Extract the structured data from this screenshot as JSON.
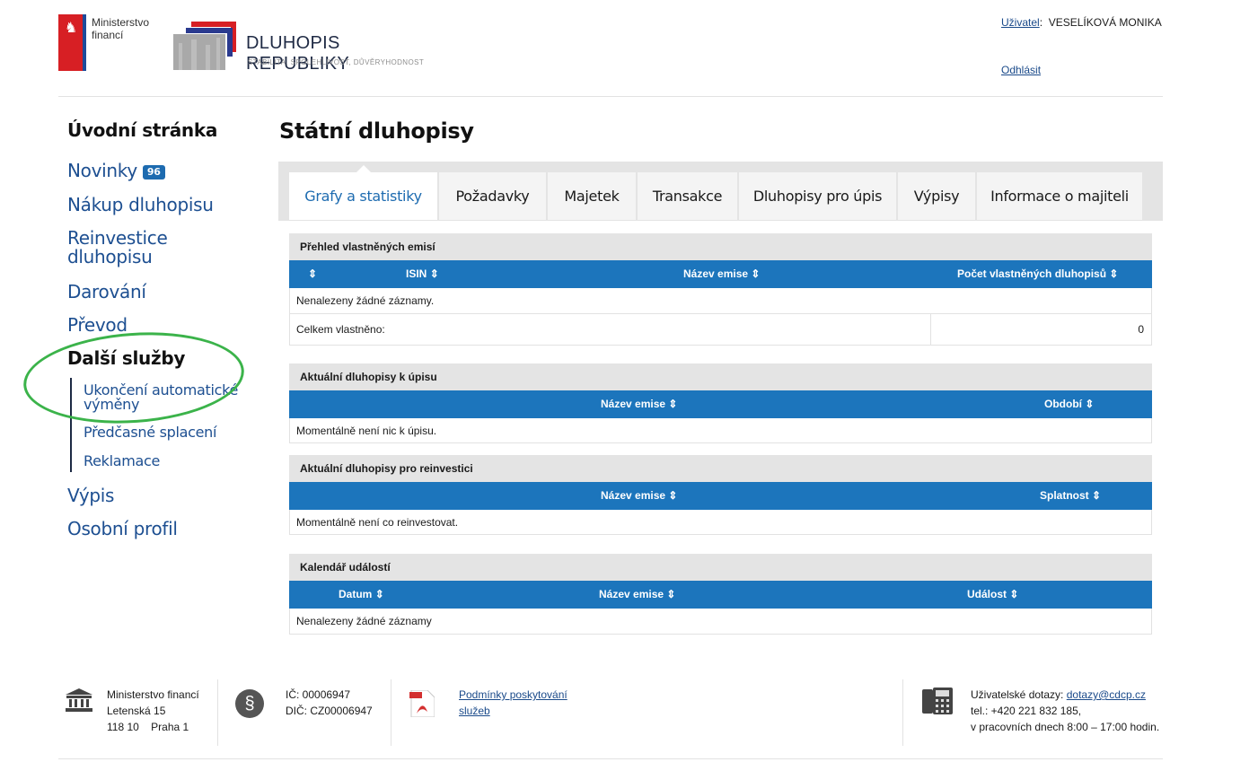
{
  "header": {
    "ministry_name_line1": "Ministerstvo",
    "ministry_name_line2": "financí",
    "brand_title": "DLUHOPIS REPUBLIKY",
    "brand_subtitle": "STABILITA, SPOLEHLIVOST, DŮVĚRYHODNOST",
    "user_label": "Uživatel",
    "user_name": "VESELÍKOVÁ MONIKA",
    "logout_label": "Odhlásit"
  },
  "sidebar": {
    "home": "Úvodní stránka",
    "news": "Novinky",
    "news_badge": "96",
    "purchase": "Nákup dluhopisu",
    "reinvest_line1": "Reinvestice",
    "reinvest_line2": "dluhopisu",
    "donation": "Darování",
    "transfer": "Převod",
    "more_services": "Další služby",
    "sub": {
      "auto_exchange_line1": "Ukončení automatické",
      "auto_exchange_line2": "výměny",
      "early_repayment": "Předčasné splacení",
      "complaints": "Reklamace"
    },
    "statement": "Výpis",
    "profile": "Osobní profil"
  },
  "main": {
    "page_title": "Státní dluhopisy",
    "tabs": [
      {
        "label": "Grafy a statistiky"
      },
      {
        "label": "Požadavky"
      },
      {
        "label": "Majetek"
      },
      {
        "label": "Transakce"
      },
      {
        "label": "Dluhopisy pro úpis"
      },
      {
        "label": "Výpisy"
      },
      {
        "label": "Informace o majiteli"
      }
    ],
    "sort_icon": "⇕",
    "owned": {
      "title": "Přehled vlastněných emisí",
      "col_isin": "ISIN",
      "col_name": "Název emise",
      "col_count": "Počet vlastněných dluhopisů",
      "empty": "Nenalezeny žádné záznamy.",
      "total_label": "Celkem vlastněno:",
      "total_value": "0"
    },
    "current": {
      "title": "Aktuální dluhopisy k úpisu",
      "col_name": "Název emise",
      "col_period": "Období",
      "empty": "Momentálně není nic k úpisu."
    },
    "reinvest": {
      "title": "Aktuální dluhopisy pro reinvestici",
      "col_name": "Název emise",
      "col_maturity": "Splatnost",
      "empty": "Momentálně není co reinvestovat."
    },
    "calendar": {
      "title": "Kalendář událostí",
      "col_date": "Datum",
      "col_name": "Název emise",
      "col_event": "Událost",
      "empty": "Nenalezeny žádné záznamy"
    }
  },
  "footer": {
    "address_line1": "Ministerstvo financí",
    "address_line2": "Letenská 15",
    "address_line3": "118 10    Praha 1",
    "ic": "IČ: 00006947",
    "dic": "DIČ: CZ00006947",
    "terms_line1": "Podmínky poskytování",
    "terms_line2": "služeb",
    "contact_label": "Uživatelské dotazy:",
    "contact_email": "dotazy@cdcp.cz",
    "contact_phone": "tel.: +420 221 832 185,",
    "contact_hours": "v pracovních dnech 8:00 – 17:00 hodin."
  },
  "colors": {
    "table_header": "#1c75bc",
    "link": "#1d4f91",
    "highlight": "#3bb34a"
  }
}
